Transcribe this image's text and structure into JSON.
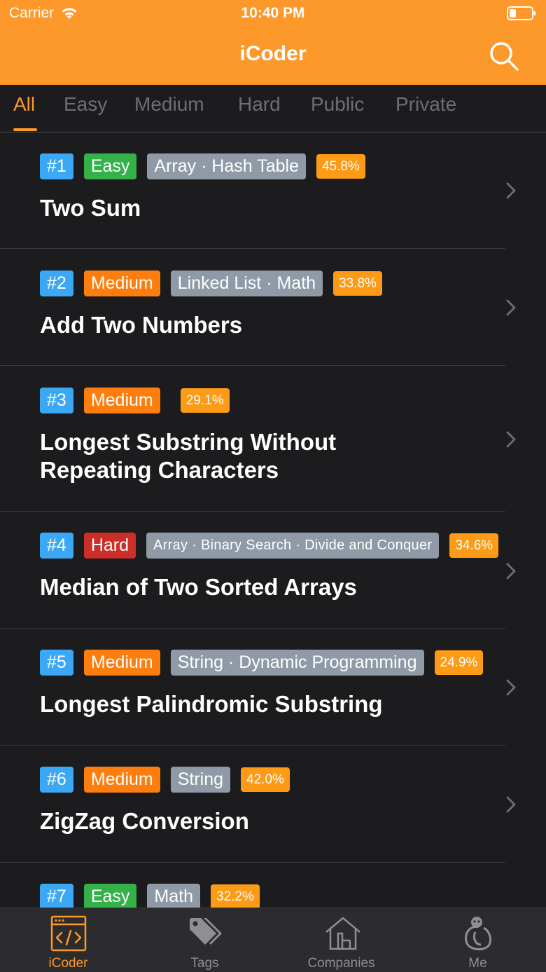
{
  "status_bar": {
    "carrier": "Carrier",
    "time": "10:40 PM"
  },
  "nav": {
    "title": "iCoder"
  },
  "filters": [
    "All",
    "Easy",
    "Medium",
    "Hard",
    "Public",
    "Private"
  ],
  "problems": [
    {
      "id": "#1",
      "difficulty": "Easy",
      "topics": "Array · Hash Table",
      "rate": "45.8%",
      "title": "Two Sum"
    },
    {
      "id": "#2",
      "difficulty": "Medium",
      "topics": "Linked List · Math",
      "rate": "33.8%",
      "title": "Add Two Numbers"
    },
    {
      "id": "#3",
      "difficulty": "Medium",
      "topics": "",
      "rate": "29.1%",
      "title": "Longest Substring Without Repeating Characters"
    },
    {
      "id": "#4",
      "difficulty": "Hard",
      "topics": "Array · Binary Search · Divide and Conquer",
      "rate": "34.6%",
      "title": "Median of Two Sorted Arrays"
    },
    {
      "id": "#5",
      "difficulty": "Medium",
      "topics": "String · Dynamic Programming",
      "rate": "24.9%",
      "title": "Longest Palindromic Substring"
    },
    {
      "id": "#6",
      "difficulty": "Medium",
      "topics": "String",
      "rate": "42.0%",
      "title": "ZigZag Conversion"
    },
    {
      "id": "#7",
      "difficulty": "Easy",
      "topics": "Math",
      "rate": "32.2%",
      "title": ""
    }
  ],
  "tabbar": {
    "items": [
      {
        "label": "iCoder",
        "icon": "code-window-icon"
      },
      {
        "label": "Tags",
        "icon": "tags-icon"
      },
      {
        "label": "Companies",
        "icon": "companies-icon"
      },
      {
        "label": "Me",
        "icon": "me-icon"
      }
    ]
  },
  "colors": {
    "accent": "#fd982a",
    "easy": "#35b14a",
    "medium": "#fd7d0e",
    "hard": "#cc2f27",
    "id": "#3aa8f5",
    "topic": "#8f9aa6",
    "background": "#1c1c1e"
  }
}
